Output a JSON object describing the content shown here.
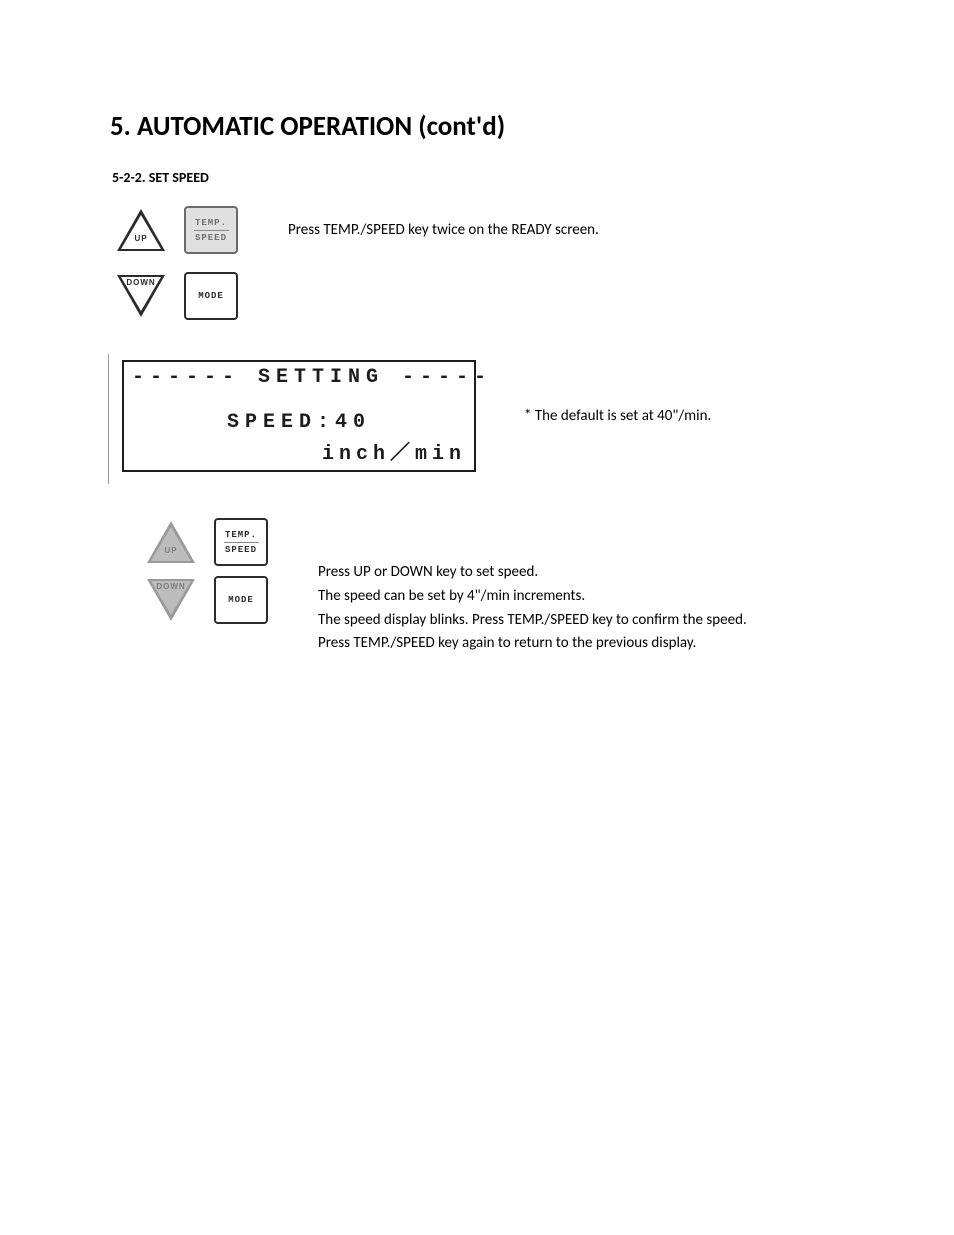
{
  "title": "5. AUTOMATIC OPERATION (cont'd)",
  "subsection": "5-2-2. SET SPEED",
  "keypad": {
    "up": "UP",
    "down": "DOWN",
    "temp_speed_l1": "TEMP.",
    "temp_speed_l2": "SPEED",
    "mode": "MODE"
  },
  "step1_text": "Press TEMP./SPEED key twice on the READY screen.",
  "lcd": {
    "line1": "------ SETTING -----",
    "line2": "SPEED:40",
    "line3": "inch／min"
  },
  "lcd_note": "* The default is set at 40\"/min.",
  "step2": {
    "p1": "Press UP or DOWN key to set speed.",
    "p2": "The speed can be set by 4\"/min increments.",
    "p3": "The speed display blinks. Press TEMP./SPEED key to confirm the speed.",
    "p4": "Press TEMP./SPEED key again to return to the previous display."
  }
}
